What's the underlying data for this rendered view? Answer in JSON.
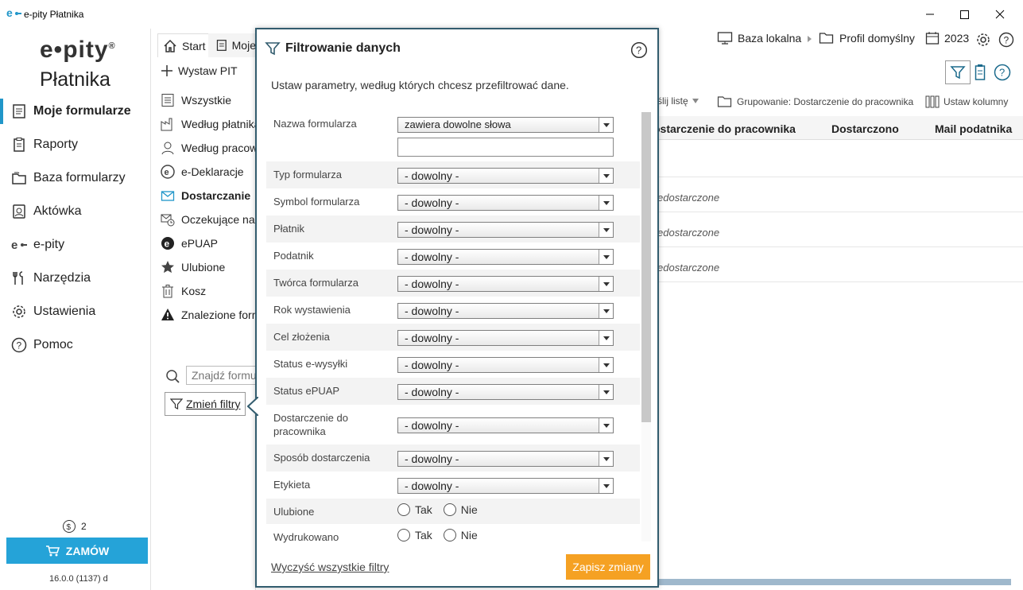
{
  "window": {
    "title": "e-pity Płatnika",
    "logo_mini": "e•"
  },
  "sidebar": {
    "brand_top": "e•pity",
    "brand_registered": "®",
    "brand_sub": "Płatnika",
    "items": [
      {
        "label": "Moje formularze",
        "icon": "document-icon"
      },
      {
        "label": "Raporty",
        "icon": "clipboard-icon"
      },
      {
        "label": "Baza formularzy",
        "icon": "folders-icon"
      },
      {
        "label": "Aktówka",
        "icon": "briefcase-icon"
      },
      {
        "label": "e-pity",
        "icon": "epity-icon"
      },
      {
        "label": "Narzędzia",
        "icon": "tools-icon"
      },
      {
        "label": "Ustawienia",
        "icon": "gear-icon"
      },
      {
        "label": "Pomoc",
        "icon": "help-icon"
      }
    ],
    "coins": "2",
    "order_label": "ZAMÓW",
    "version": "16.0.0 (1137) d"
  },
  "tabs": {
    "start": "Start",
    "moje": "Moje"
  },
  "col2": {
    "wystaw": "Wystaw PIT",
    "items": [
      {
        "label": "Wszystkie",
        "icon": "list-icon"
      },
      {
        "label": "Według płatnika",
        "icon": "factory-icon"
      },
      {
        "label": "Według pracownika",
        "icon": "person-icon"
      },
      {
        "label": "e-Deklaracje",
        "icon": "edeklaracje-icon"
      },
      {
        "label": "Dostarczanie",
        "icon": "envelope-icon"
      },
      {
        "label": "Oczekujące na",
        "icon": "mail-clock-icon"
      },
      {
        "label": "ePUAP",
        "icon": "epuap-icon"
      },
      {
        "label": "Ulubione",
        "icon": "star-icon"
      },
      {
        "label": "Kosz",
        "icon": "trash-icon"
      },
      {
        "label": "Znalezione formularze",
        "icon": "warning-icon"
      }
    ],
    "search_placeholder": "Znajdź formularz",
    "change_filters": "Zmień filtry"
  },
  "main": {
    "baza": "Baza lokalna",
    "profil": "Profil domyślny",
    "year": "2023",
    "toolbar_list": "ślij listę",
    "grouping": "Grupowanie: Dostarczenie do pracownika",
    "columns": "Ustaw kolumny",
    "columns_extra": "i",
    "headers": [
      "ostarczenie do pracownika",
      "Dostarczono",
      "Mail podatnika"
    ],
    "cells": [
      "edostarczone",
      "edostarczone",
      "edostarczone"
    ]
  },
  "popup": {
    "title": "Filtrowanie danych",
    "description": "Ustaw parametry, według których chcesz przefiltrować dane.",
    "name_field": {
      "label": "Nazwa formularza",
      "mode": "zawiera dowolne słowa",
      "value": ""
    },
    "filters": [
      {
        "label": "Typ formularza",
        "value": "- dowolny -"
      },
      {
        "label": "Symbol formularza",
        "value": "- dowolny -"
      },
      {
        "label": "Płatnik",
        "value": "- dowolny -"
      },
      {
        "label": "Podatnik",
        "value": "- dowolny -"
      },
      {
        "label": "Twórca formularza",
        "value": "- dowolny -"
      },
      {
        "label": "Rok wystawienia",
        "value": "- dowolny -"
      },
      {
        "label": "Cel złożenia",
        "value": "- dowolny -"
      },
      {
        "label": "Status e-wysyłki",
        "value": "- dowolny -"
      },
      {
        "label": "Status ePUAP",
        "value": "- dowolny -"
      },
      {
        "label": "Dostarczenie do pracownika",
        "value": "- dowolny -"
      },
      {
        "label": "Sposób dostarczenia",
        "value": "- dowolny -"
      },
      {
        "label": "Etykieta",
        "value": "- dowolny -"
      }
    ],
    "radios": [
      {
        "label": "Ulubione",
        "yes": "Tak",
        "no": "Nie"
      },
      {
        "label": "Wydrukowano",
        "yes": "Tak",
        "no": "Nie"
      }
    ],
    "clear_label": "Wyczyść wszystkie filtry",
    "save_label": "Zapisz zmiany"
  },
  "colors": {
    "accent": "#2196c9",
    "order": "#25a3d8",
    "save": "#f5a123",
    "popup_border": "#325c6e"
  }
}
